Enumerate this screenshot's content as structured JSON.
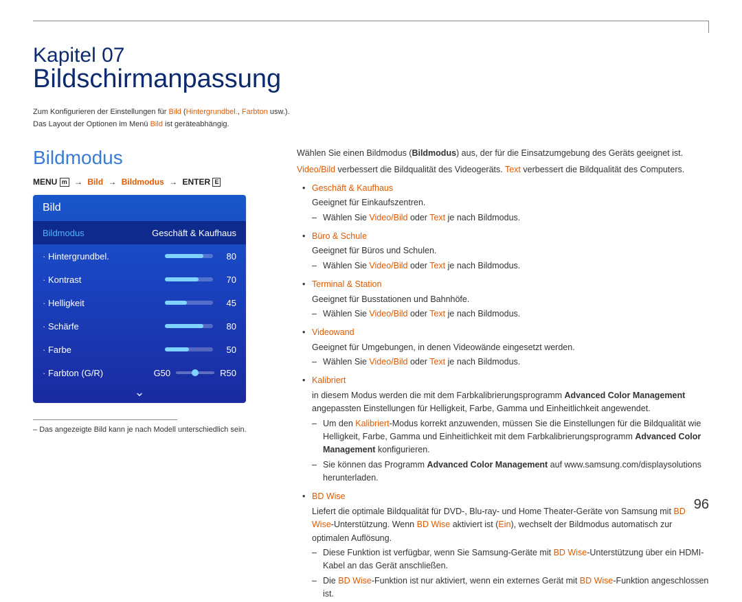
{
  "page_number": "96",
  "chapter": "Kapitel 07",
  "title": "Bildschirmanpassung",
  "intro": {
    "line1_a": "Zum Konfigurieren der Einstellungen für ",
    "line1_b": "Bild",
    "line1_c": " (",
    "line1_d": "Hintergrundbel.",
    "line1_e": ", ",
    "line1_f": "Farbton",
    "line1_g": " usw.).",
    "line2_a": "Das Layout der Optionen im Menü ",
    "line2_b": "Bild",
    "line2_c": " ist geräteabhängig."
  },
  "left": {
    "heading": "Bildmodus",
    "path": {
      "menu": "MENU",
      "l1": "Bild",
      "l2": "Bildmodus",
      "enter": "ENTER",
      "icon_menu": "m",
      "icon_enter": "E"
    },
    "tv": {
      "title": "Bild",
      "sel_label": "Bildmodus",
      "sel_value": "Geschäft & Kaufhaus",
      "rows": [
        {
          "label": "Hintergrundbel.",
          "value": 80
        },
        {
          "label": "Kontrast",
          "value": 70
        },
        {
          "label": "Helligkeit",
          "value": 45
        },
        {
          "label": "Schärfe",
          "value": 80
        },
        {
          "label": "Farbe",
          "value": 50
        }
      ],
      "tone": {
        "label": "Farbton (G/R)",
        "g": "G50",
        "r": "R50"
      }
    },
    "footnote": "Das angezeigte Bild kann je nach Modell unterschiedlich sein."
  },
  "right": {
    "p1_a": "Wählen Sie einen Bildmodus (",
    "p1_b": "Bildmodus",
    "p1_c": ") aus, der für die Einsatzumgebung des Geräts geeignet ist.",
    "p2_a": "Video/Bild",
    "p2_b": " verbessert die Bildqualität des Videogeräts. ",
    "p2_c": "Text",
    "p2_d": " verbessert die Bildqualität des Computers.",
    "items": {
      "a": {
        "head": "Geschäft & Kaufhaus",
        "desc": "Geeignet für Einkaufszentren.",
        "sub_a": "Wählen Sie ",
        "sub_b": "Video/Bild",
        "sub_c": " oder ",
        "sub_d": "Text",
        "sub_e": " je nach Bildmodus."
      },
      "b": {
        "head": "Büro & Schule",
        "desc": "Geeignet für Büros und Schulen."
      },
      "c": {
        "head": "Terminal & Station",
        "desc": "Geeignet für Busstationen und Bahnhöfe."
      },
      "d": {
        "head": "Videowand",
        "desc": "Geeignet für Umgebungen, in denen Videowände eingesetzt werden."
      },
      "e": {
        "head": "Kalibriert",
        "desc_a": "in diesem Modus werden die mit dem Farbkalibrierungsprogramm ",
        "desc_b": "Advanced Color Management",
        "desc_c": " angepassten Einstellungen für Helligkeit, Farbe, Gamma und Einheitlichkeit angewendet.",
        "s1_a": "Um den ",
        "s1_b": "Kalibriert",
        "s1_c": "-Modus korrekt anzuwenden, müssen Sie die Einstellungen für die Bildqualität wie Helligkeit, Farbe, Gamma und Einheitlichkeit mit dem Farbkalibrierungsprogramm ",
        "s1_d": "Advanced Color Management",
        "s1_e": " konfigurieren.",
        "s2_a": "Sie können das Programm ",
        "s2_b": "Advanced Color Management",
        "s2_c": " auf www.samsung.com/displaysolutions herunterladen."
      },
      "f": {
        "head": "BD Wise",
        "desc_a": "Liefert die optimale Bildqualität für DVD-, Blu-ray- und Home Theater-Geräte von Samsung mit ",
        "desc_b": "BD Wise",
        "desc_c": "-Unterstützung. Wenn ",
        "desc_d": "BD Wise",
        "desc_e": " aktiviert ist (",
        "desc_f": "Ein",
        "desc_g": "), wechselt der Bildmodus automatisch zur optimalen Auflösung.",
        "s1_a": "Diese Funktion ist verfügbar, wenn Sie Samsung-Geräte mit ",
        "s1_b": "BD Wise",
        "s1_c": "-Unterstützung über ein HDMI-Kabel an das Gerät anschließen.",
        "s2_a": "Die ",
        "s2_b": "BD Wise",
        "s2_c": "-Funktion ist nur aktiviert, wenn ein externes Gerät mit ",
        "s2_d": "BD Wise",
        "s2_e": "-Funktion angeschlossen ist."
      }
    }
  }
}
